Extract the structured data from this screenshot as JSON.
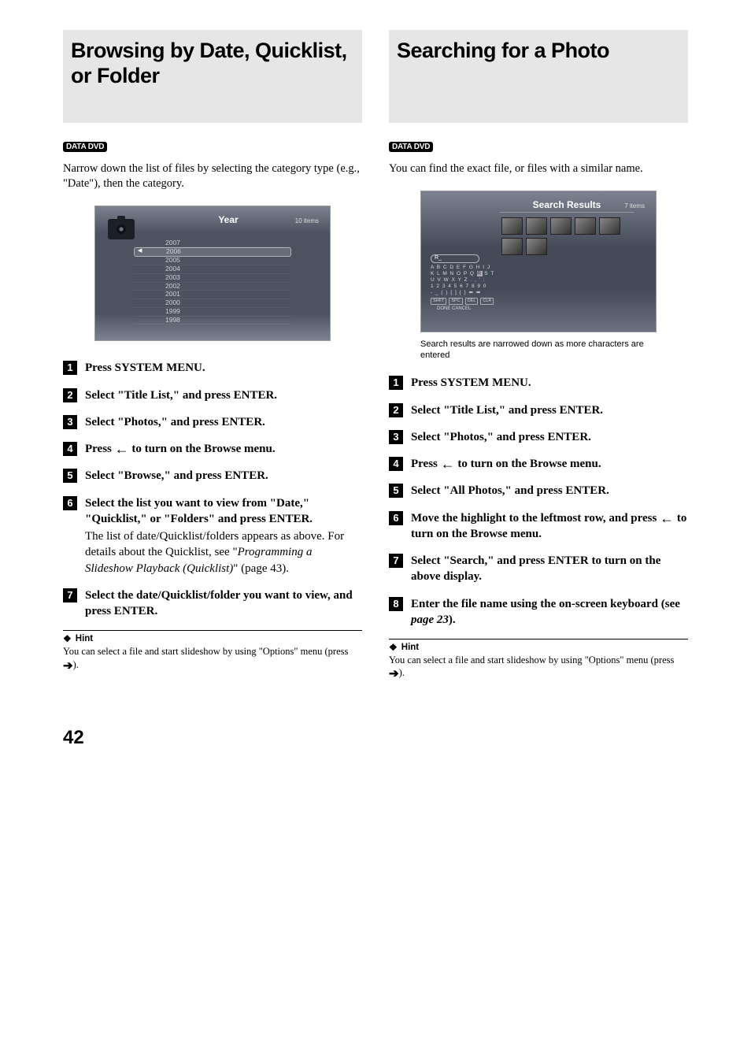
{
  "page_number": "42",
  "left": {
    "title": "Browsing by Date, Quicklist, or Folder",
    "badge": "DATA DVD",
    "intro": "Narrow down the list of files by selecting the category type (e.g., \"Date\"), then the category.",
    "screen": {
      "title": "Year",
      "count": "10 items",
      "years": [
        "2007",
        "2006",
        "2005",
        "2004",
        "2003",
        "2002",
        "2001",
        "2000",
        "1999",
        "1998"
      ],
      "selected_index": 1
    },
    "steps": [
      {
        "n": "1",
        "head": "Press SYSTEM MENU."
      },
      {
        "n": "2",
        "head": "Select \"Title List,\" and press ENTER."
      },
      {
        "n": "3",
        "head": "Select \"Photos,\" and press ENTER."
      },
      {
        "n": "4",
        "head_pre": "Press ",
        "arrow": "left",
        "head_post": " to turn on the Browse menu."
      },
      {
        "n": "5",
        "head": "Select \"Browse,\" and press ENTER."
      },
      {
        "n": "6",
        "head": "Select the list you want to view from \"Date,\" \"Quicklist,\" or \"Folders\" and press ENTER.",
        "rest_pre": "The list of date/Quicklist/folders appears as above. For details about the Quicklist, see \"",
        "rest_ital": "Programming a Slideshow Playback (Quicklist)",
        "rest_post": "\" (page 43)."
      },
      {
        "n": "7",
        "head": "Select the date/Quicklist/folder you want to view, and press ENTER."
      }
    ],
    "hint_label": "Hint",
    "hint_pre": "You can select a file and start slideshow by using \"Options\" menu (press ",
    "hint_post": ")."
  },
  "right": {
    "title": "Searching for a Photo",
    "badge": "DATA DVD",
    "intro": "You can find the exact file, or files with a similar name.",
    "screen": {
      "title": "Search Results",
      "count": "7 items",
      "input": "R_",
      "kb_rows": [
        "A B C D E F G H I J",
        "K L M N O P Q R S T",
        "U V W X Y Z . , ' :",
        "1 2 3 4 5 6 7 8 9 0",
        "- _ ( ) [ ] { } ⬅ ➡"
      ],
      "kb_btns": [
        "SHFT",
        "SPC",
        "DEL",
        "CLR"
      ],
      "kb_labels": "DONE    CANCEL"
    },
    "caption": "Search results are narrowed down as more characters are entered",
    "steps": [
      {
        "n": "1",
        "head": "Press SYSTEM MENU."
      },
      {
        "n": "2",
        "head": "Select \"Title List,\" and press ENTER."
      },
      {
        "n": "3",
        "head": "Select \"Photos,\" and press ENTER."
      },
      {
        "n": "4",
        "head_pre": "Press ",
        "arrow": "left",
        "head_post": " to turn on the Browse menu."
      },
      {
        "n": "5",
        "head": "Select \"All Photos,\" and press ENTER."
      },
      {
        "n": "6",
        "head_pre": "Move the highlight to the leftmost row, and press ",
        "arrow": "left",
        "head_post": " to turn on the Browse menu."
      },
      {
        "n": "7",
        "head": "Select \"Search,\" and press ENTER to turn on the above display."
      },
      {
        "n": "8",
        "head_pre": "Enter the file name using the on-screen keyboard (see ",
        "head_ital": "page 23",
        "head_post2": ")."
      }
    ],
    "hint_label": "Hint",
    "hint_pre": "You can select a file and start slideshow by using \"Options\" menu (press ",
    "hint_post": ")."
  }
}
